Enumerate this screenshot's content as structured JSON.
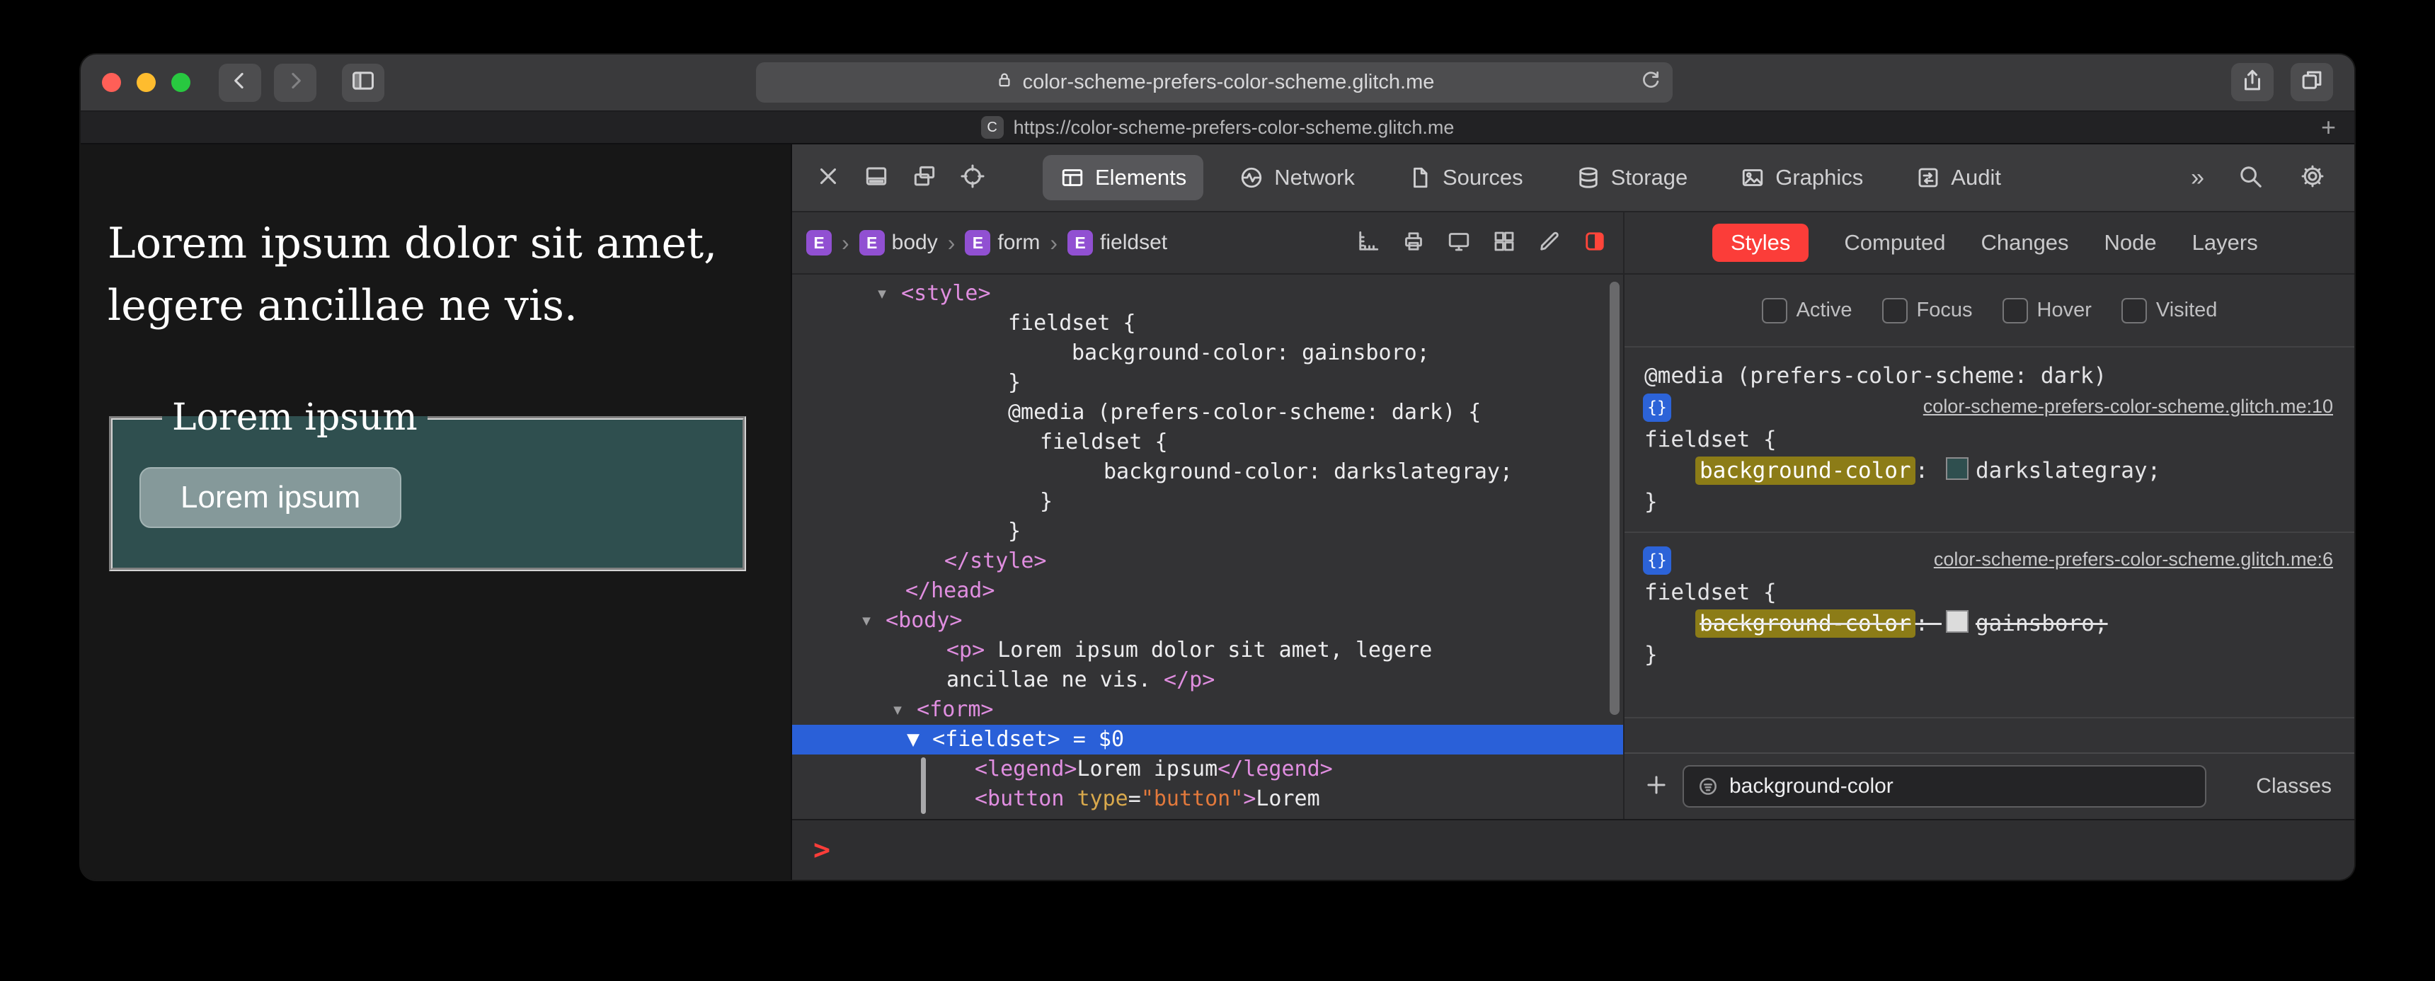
{
  "chrome": {
    "address": "color-scheme-prefers-color-scheme.glitch.me",
    "tab_url": "https://color-scheme-prefers-color-scheme.glitch.me",
    "tab_favicon_letter": "C",
    "new_tab_glyph": "+"
  },
  "page": {
    "paragraph_line1": "Lorem ipsum dolor sit amet,",
    "paragraph_line2": "legere ancillae ne vis.",
    "fieldset_legend": "Lorem ipsum",
    "button_label": "Lorem ipsum",
    "colors": {
      "page_background": "#171717",
      "fieldset_background": "#2f4f4f",
      "text": "#ffffff",
      "button_background": "#85999a"
    }
  },
  "devtools": {
    "toolbar_icons_left": [
      "close",
      "dock-bottom",
      "dock-detach",
      "inspect-target"
    ],
    "tabs": [
      {
        "icon": "elements",
        "label": "Elements",
        "selected": true
      },
      {
        "icon": "network",
        "label": "Network",
        "selected": false
      },
      {
        "icon": "sources",
        "label": "Sources",
        "selected": false
      },
      {
        "icon": "storage",
        "label": "Storage",
        "selected": false
      },
      {
        "icon": "graphics",
        "label": "Graphics",
        "selected": false
      },
      {
        "icon": "audit",
        "label": "Audit",
        "selected": false
      }
    ],
    "more_tabs_glyph": "»",
    "breadcrumbs": [
      {
        "badge": "E",
        "label": ""
      },
      {
        "badge": "E",
        "label": "body"
      },
      {
        "badge": "E",
        "label": "form"
      },
      {
        "badge": "E",
        "label": "fieldset"
      }
    ],
    "crumb_separator": "›",
    "crumb_icons": [
      "rulers",
      "print",
      "device",
      "grid",
      "edit",
      "appearance"
    ],
    "dom_lines": [
      {
        "indent": 118,
        "selected": false,
        "segs": [
          [
            "▾ ",
            "tri"
          ],
          [
            "<style>",
            "tag"
          ]
        ]
      },
      {
        "indent": 305,
        "selected": false,
        "segs": [
          [
            "fieldset {",
            "plain"
          ]
        ]
      },
      {
        "indent": 395,
        "selected": false,
        "segs": [
          [
            "background-color: gainsboro;",
            "plain"
          ]
        ]
      },
      {
        "indent": 305,
        "selected": false,
        "segs": [
          [
            "}",
            "plain"
          ]
        ]
      },
      {
        "indent": 305,
        "selected": false,
        "segs": [
          [
            "@media (prefers-color-scheme: dark) {",
            "plain"
          ]
        ]
      },
      {
        "indent": 350,
        "selected": false,
        "segs": [
          [
            "fieldset {",
            "plain"
          ]
        ]
      },
      {
        "indent": 440,
        "selected": false,
        "segs": [
          [
            "background-color: darkslategray;",
            "plain"
          ]
        ]
      },
      {
        "indent": 350,
        "selected": false,
        "segs": [
          [
            "}",
            "plain"
          ]
        ]
      },
      {
        "indent": 305,
        "selected": false,
        "segs": [
          [
            "}",
            "plain"
          ]
        ]
      },
      {
        "indent": 215,
        "selected": false,
        "segs": [
          [
            "</style>",
            "tag"
          ]
        ]
      },
      {
        "indent": 160,
        "selected": false,
        "segs": [
          [
            "</head>",
            "tag"
          ]
        ]
      },
      {
        "indent": 96,
        "selected": false,
        "segs": [
          [
            "▾ ",
            "tri"
          ],
          [
            "<body>",
            "tag"
          ]
        ]
      },
      {
        "indent": 218,
        "selected": false,
        "segs": [
          [
            "<p>",
            "tag"
          ],
          [
            " Lorem ipsum dolor sit amet, legere",
            "plain"
          ]
        ]
      },
      {
        "indent": 218,
        "selected": false,
        "segs": [
          [
            "ancillae ne vis. ",
            "plain"
          ],
          [
            "</p>",
            "tag"
          ]
        ]
      },
      {
        "indent": 140,
        "selected": false,
        "segs": [
          [
            "▾ ",
            "tri"
          ],
          [
            "<form>",
            "tag"
          ]
        ]
      },
      {
        "indent": 162,
        "selected": true,
        "segs": [
          [
            "▼ ",
            "tri"
          ],
          [
            "<fieldset>",
            "tag"
          ],
          [
            " = $0",
            "plain"
          ]
        ]
      },
      {
        "indent": 258,
        "selected": false,
        "segs": [
          [
            "<legend>",
            "tag"
          ],
          [
            "Lorem ipsum",
            "plain"
          ],
          [
            "</legend>",
            "tag"
          ]
        ]
      },
      {
        "indent": 258,
        "selected": false,
        "segs": [
          [
            "<button",
            "tag"
          ],
          [
            " ",
            "plain"
          ],
          [
            "type",
            "attr"
          ],
          [
            "=",
            "plain"
          ],
          [
            "\"button\"",
            "val"
          ],
          [
            ">",
            "tag"
          ],
          [
            "Lorem",
            "plain"
          ]
        ]
      }
    ],
    "sidebar_tabs": [
      {
        "label": "Styles",
        "selected": true
      },
      {
        "label": "Computed",
        "selected": false
      },
      {
        "label": "Changes",
        "selected": false
      },
      {
        "label": "Node",
        "selected": false
      },
      {
        "label": "Layers",
        "selected": false
      }
    ],
    "pseudo_states": [
      "Active",
      "Focus",
      "Hover",
      "Visited"
    ],
    "rules": [
      {
        "media": "@media (prefers-color-scheme: dark)",
        "source_link": "color-scheme-prefers-color-scheme.glitch.me:10",
        "selector": "fieldset {",
        "property": "background-color",
        "colon": ": ",
        "value": "darkslategray",
        "semicolon": ";",
        "swatch_color": "#2f4f4f",
        "overridden": false,
        "close_brace": "}"
      },
      {
        "media": null,
        "source_link": "color-scheme-prefers-color-scheme.glitch.me:6",
        "selector": "fieldset {",
        "property": "background-color",
        "colon": ": ",
        "value": "gainsboro",
        "semicolon": ";",
        "swatch_color": "#dcdcdc",
        "overridden": true,
        "close_brace": "}"
      }
    ],
    "new_rule_glyph": "+",
    "filter_value": "background-color",
    "classes_label": "Classes",
    "console_prompt": ">",
    "colors": {
      "selection_blue": "#2a60d8",
      "tag_pink": "#e08ee0",
      "styles_tab_red": "#fb3d39",
      "filter_highlight": "#8c7c17",
      "element_badge_purple": "#9150d2",
      "rule_badge_blue": "#2c63d8"
    }
  }
}
